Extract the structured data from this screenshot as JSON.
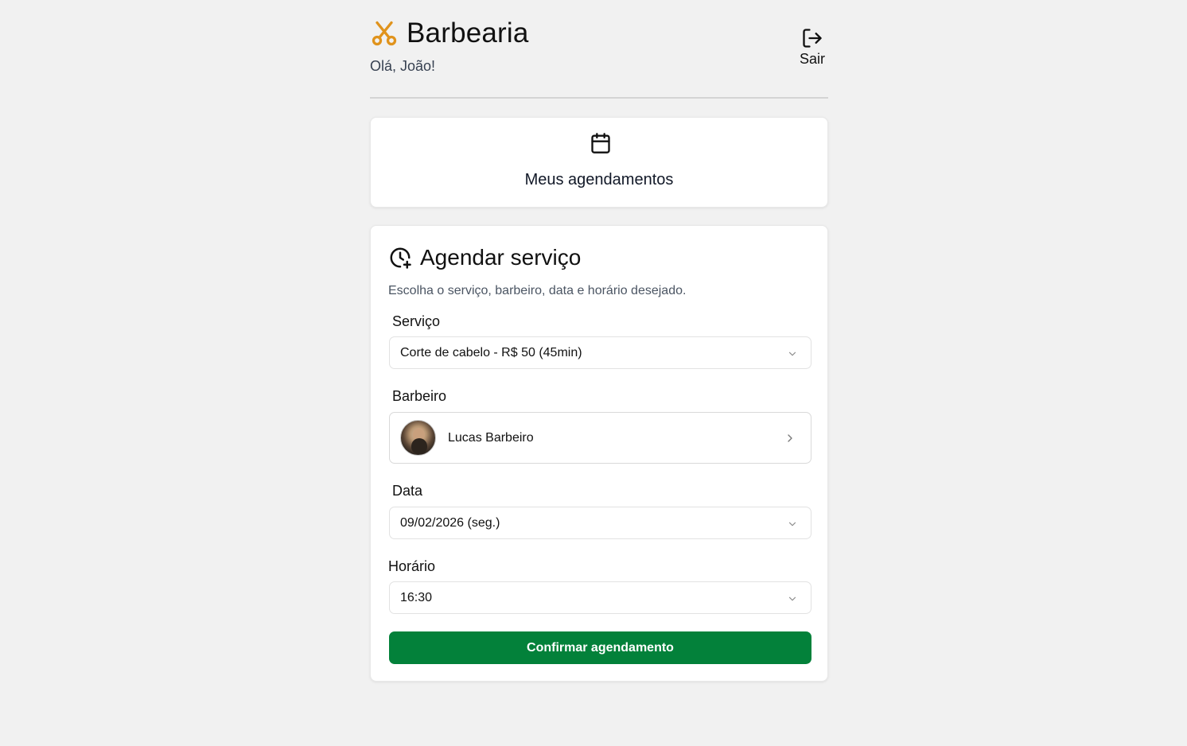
{
  "header": {
    "brand_icon": "scissors-icon",
    "brand_title": "Barbearia",
    "greeting": "Olá, João!",
    "logout_icon": "logout-icon",
    "logout_label": "Sair"
  },
  "appointments_card": {
    "icon": "calendar-icon",
    "label": "Meus agendamentos"
  },
  "schedule": {
    "icon": "clock-plus-icon",
    "title": "Agendar serviço",
    "description": "Escolha o serviço, barbeiro, data e horário desejado.",
    "service": {
      "label": "Serviço",
      "value": "Corte de cabelo - R$ 50 (45min)"
    },
    "barber": {
      "label": "Barbeiro",
      "name": "Lucas Barbeiro"
    },
    "date": {
      "label": "Data",
      "value": "09/02/2026 (seg.)"
    },
    "time": {
      "label": "Horário",
      "value": "16:30"
    },
    "confirm_label": "Confirmar agendamento"
  },
  "colors": {
    "accent_orange": "#e0931c",
    "confirm_green": "#03813a",
    "background": "#f1f1f1"
  }
}
